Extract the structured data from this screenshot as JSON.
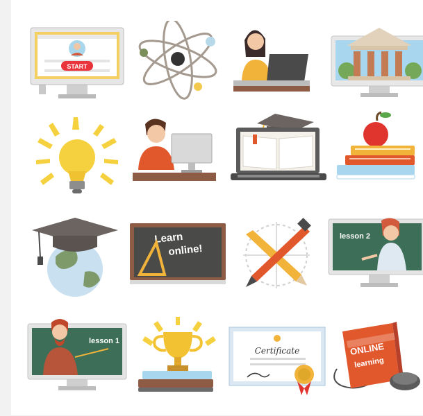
{
  "icons": {
    "monitor_start": {
      "button_label": "START"
    },
    "chalkboard": {
      "line1": "Learn",
      "line2": "online!"
    },
    "monitor_lesson2": {
      "label": "lesson 2"
    },
    "monitor_lesson1": {
      "label": "lesson 1"
    },
    "certificate": {
      "title": "Certificate"
    },
    "online_book": {
      "line1": "ONLINE",
      "line2": "learning"
    }
  }
}
